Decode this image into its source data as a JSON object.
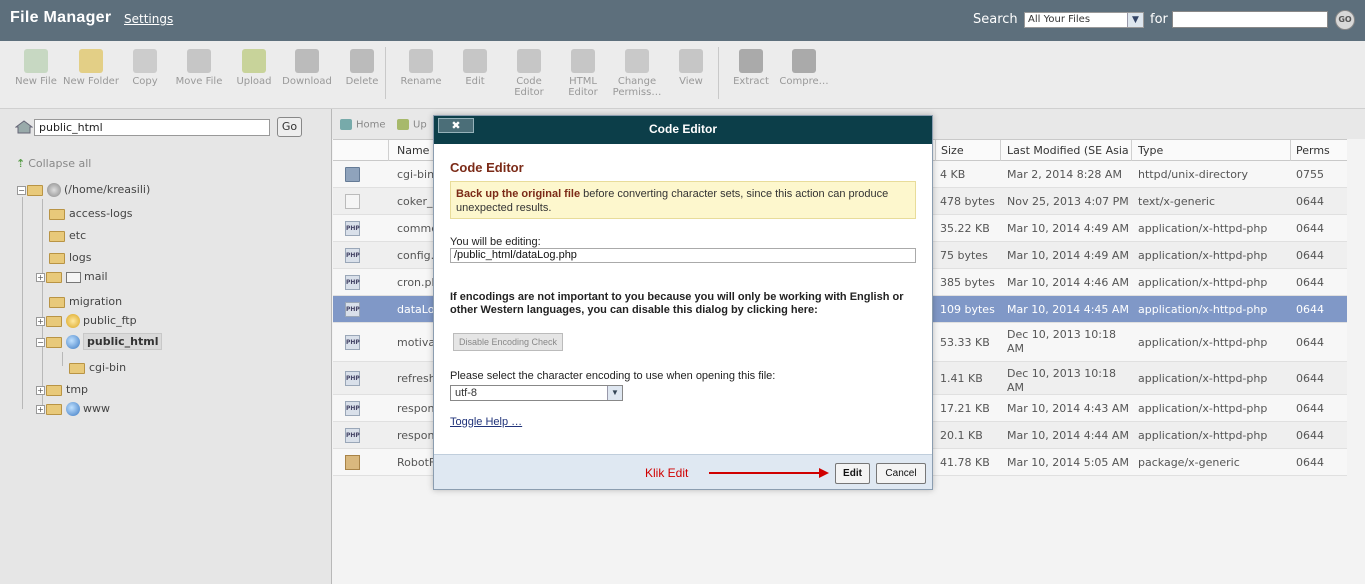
{
  "header": {
    "title": "File Manager",
    "settings_label": "Settings",
    "search_label": "Search",
    "search_scope": "All Your Files",
    "for_label": "for",
    "go_label": "GO"
  },
  "toolbar": [
    {
      "label": "New File",
      "icon": "new-file-icon"
    },
    {
      "label": "New Folder",
      "icon": "new-folder-icon"
    },
    {
      "label": "Copy",
      "icon": "copy-icon"
    },
    {
      "label": "Move File",
      "icon": "move-file-icon"
    },
    {
      "label": "Upload",
      "icon": "upload-icon"
    },
    {
      "label": "Download",
      "icon": "download-icon"
    },
    {
      "label": "Delete",
      "icon": "delete-icon"
    },
    {
      "label": "Rename",
      "icon": "rename-icon"
    },
    {
      "label": "Edit",
      "icon": "edit-icon"
    },
    {
      "label": "Code Editor",
      "icon": "code-editor-icon"
    },
    {
      "label": "HTML Editor",
      "icon": "html-editor-icon"
    },
    {
      "label": "Change Permiss…",
      "icon": "change-permissions-icon"
    },
    {
      "label": "View",
      "icon": "view-icon"
    },
    {
      "label": "Extract",
      "icon": "extract-icon"
    },
    {
      "label": "Compre…",
      "icon": "compress-icon"
    }
  ],
  "sidebar": {
    "path_value": "public_html",
    "go_label": "Go",
    "collapse_all": "Collapse all",
    "root_label": "(/home/kreasili)",
    "tree": [
      "access-logs",
      "etc",
      "logs",
      "mail",
      "migration",
      "public_ftp",
      "public_html",
      "cgi-bin",
      "tmp",
      "www"
    ]
  },
  "breadcrumb": {
    "home": "Home",
    "up": "Up"
  },
  "table": {
    "headers": [
      "Name",
      "Size",
      "Last Modified (SE Asia St",
      "Type",
      "Perms"
    ],
    "rows": [
      {
        "name": "cgi-bin",
        "size": "4 KB",
        "modified": "Mar 2, 2014 8:28 AM",
        "type": "httpd/unix-directory",
        "perms": "0755",
        "icon": "folder-icon"
      },
      {
        "name": "coker_lo",
        "size": "478 bytes",
        "modified": "Nov 25, 2013 4:07 PM",
        "type": "text/x-generic",
        "perms": "0644",
        "icon": "text-file-icon"
      },
      {
        "name": "commer",
        "size": "35.22 KB",
        "modified": "Mar 10, 2014 4:49 AM",
        "type": "application/x-httpd-php",
        "perms": "0644",
        "icon": "php-file-icon"
      },
      {
        "name": "config.p",
        "size": "75 bytes",
        "modified": "Mar 10, 2014 4:49 AM",
        "type": "application/x-httpd-php",
        "perms": "0644",
        "icon": "php-file-icon"
      },
      {
        "name": "cron.ph",
        "size": "385 bytes",
        "modified": "Mar 10, 2014 4:46 AM",
        "type": "application/x-httpd-php",
        "perms": "0644",
        "icon": "php-file-icon"
      },
      {
        "name": "dataLog",
        "size": "109 bytes",
        "modified": "Mar 10, 2014 4:45 AM",
        "type": "application/x-httpd-php",
        "perms": "0644",
        "icon": "php-file-icon"
      },
      {
        "name": "motivas",
        "size": "53.33 KB",
        "modified": "Dec 10, 2013 10:18 AM",
        "type": "application/x-httpd-php",
        "perms": "0644",
        "icon": "php-file-icon"
      },
      {
        "name": "refresh",
        "size": "1.41 KB",
        "modified": "Dec 10, 2013 10:18 AM",
        "type": "application/x-httpd-php",
        "perms": "0644",
        "icon": "php-file-icon"
      },
      {
        "name": "respon_",
        "size": "17.21 KB",
        "modified": "Mar 10, 2014 4:43 AM",
        "type": "application/x-httpd-php",
        "perms": "0644",
        "icon": "php-file-icon"
      },
      {
        "name": "respon_",
        "size": "20.1 KB",
        "modified": "Mar 10, 2014 4:44 AM",
        "type": "application/x-httpd-php",
        "perms": "0644",
        "icon": "php-file-icon"
      },
      {
        "name": "RobotFa",
        "size": "41.78 KB",
        "modified": "Mar 10, 2014 5:05 AM",
        "type": "package/x-generic",
        "perms": "0644",
        "icon": "package-file-icon"
      }
    ]
  },
  "modal": {
    "header_title": "Code Editor",
    "close_label": "✖",
    "title": "Code Editor",
    "warning_bold": "Back up the original file",
    "warning_rest": " before converting character sets, since this action can produce unexpected results.",
    "editing_label": "You will be editing:",
    "editing_path": "/public_html/dataLog.php",
    "encoding_note": "If encodings are not important to you because you will only be working with English or other Western languages, you can disable this dialog by clicking here:",
    "disable_label": "Disable Encoding Check",
    "select_label": "Please select the character encoding to use when opening this file:",
    "encoding_value": "utf-8",
    "toggle_help": "Toggle Help …",
    "annotation": "Klik Edit",
    "edit_label": "Edit",
    "cancel_label": "Cancel"
  },
  "colors": {
    "topbar": "#5d6f7c",
    "modal_header": "#0c3e49",
    "selected_row": "#8098c7",
    "modal_title": "#7b2a17",
    "annotation": "#d00000"
  }
}
